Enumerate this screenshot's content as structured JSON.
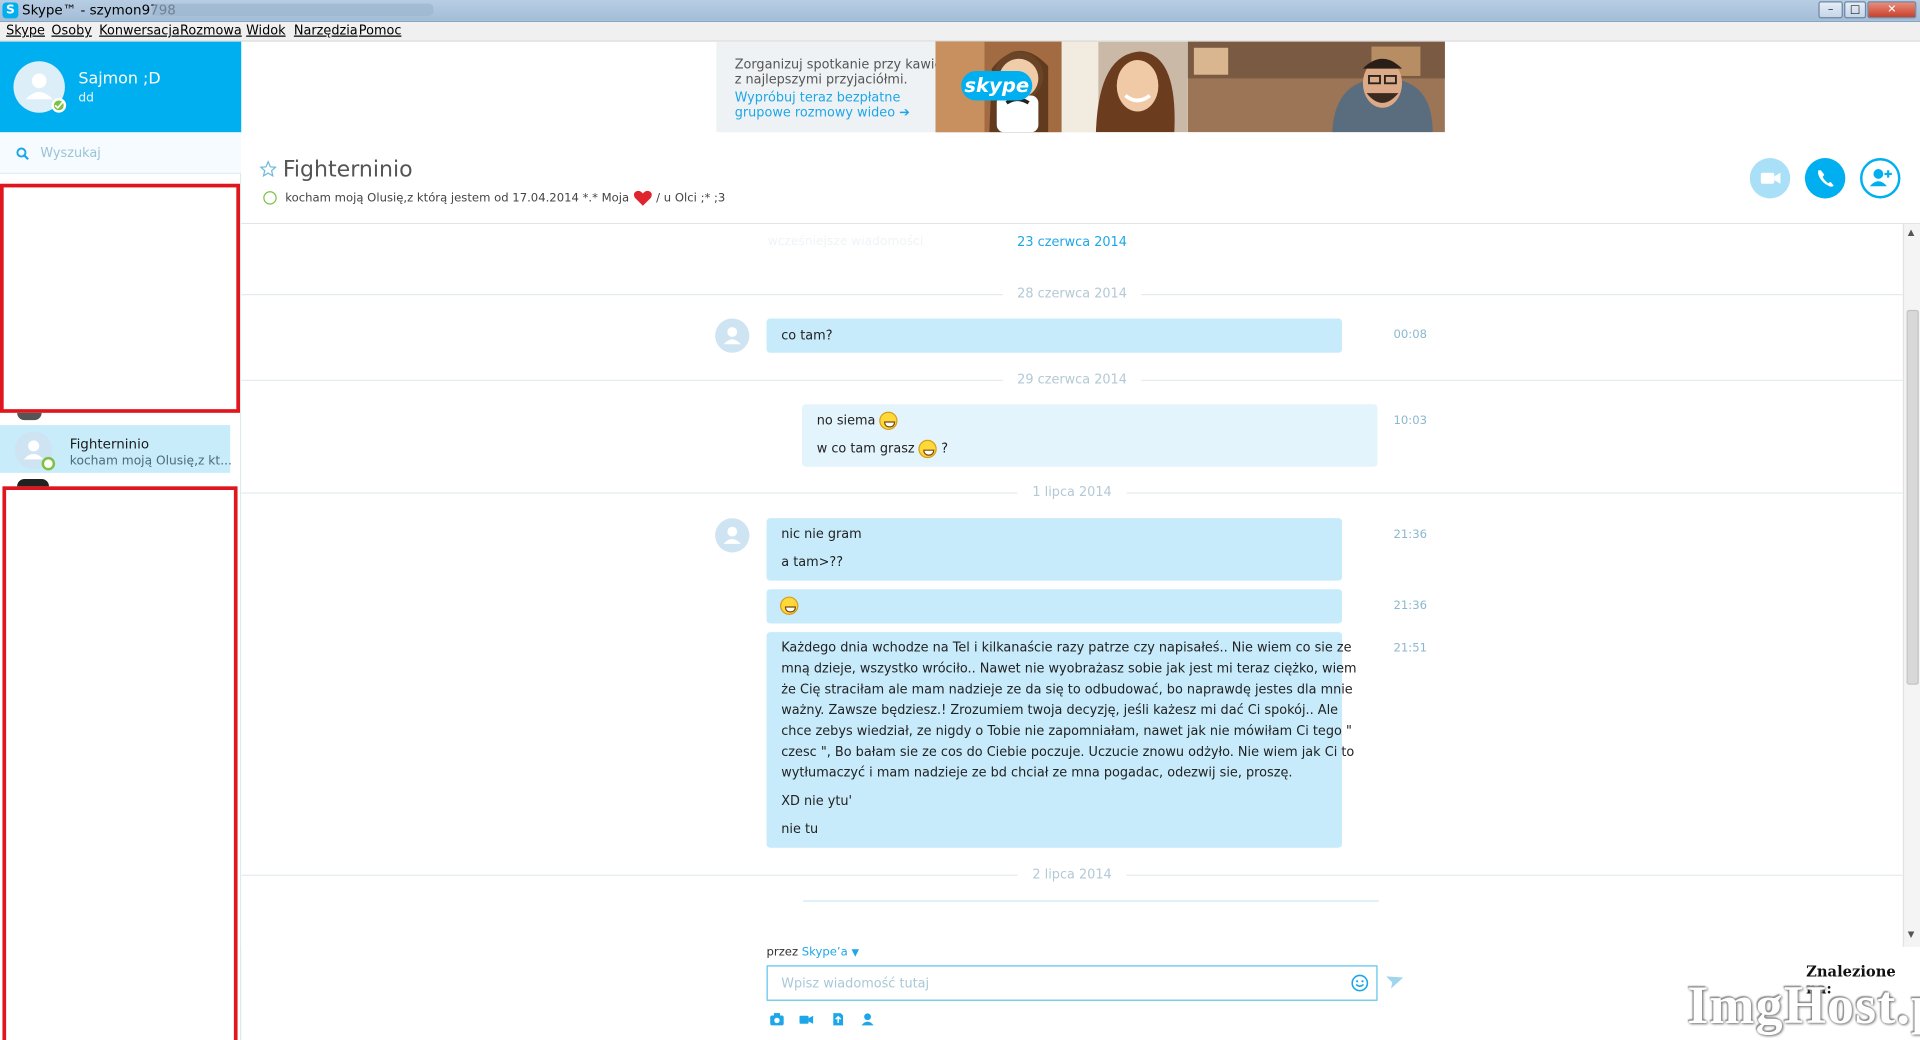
{
  "window": {
    "title": "Skype™ - szymon9798",
    "btn_min": "–",
    "btn_max": "□",
    "btn_close": "✕"
  },
  "menu": [
    "Skype",
    "Osoby",
    "Konwersacja",
    "Rozmowa",
    "Widok",
    "Narzędzia",
    "Pomoc"
  ],
  "profile": {
    "name": "Sajmon ;D",
    "mood": "dd"
  },
  "search": {
    "placeholder": "Wyszukaj"
  },
  "contact": {
    "name": "Fighterninio",
    "mood": "kocham moją Olusię,z kt..."
  },
  "banner": {
    "line1": "Zorganizuj spotkanie przy kawie z najlepszymi przyjaciółmi.",
    "line2": "Wypróbuj teraz bezpłatne grupowe rozmowy wideo ➔",
    "logo": "skype"
  },
  "conversation": {
    "title": "Fighterninio",
    "mood_before": "kocham moją Olusię,z którą jestem od 17.04.2014 *.* Moja",
    "mood_after": "/ u Olci ;* ;3"
  },
  "chat": {
    "top_link": "23 czerwca 2014",
    "groups": [
      {
        "date": "28 czerwca 2014",
        "messages": [
          {
            "side": "in",
            "lines": [
              "co tam?"
            ],
            "time": "00:08"
          }
        ]
      },
      {
        "date": "29 czerwca 2014",
        "messages": [
          {
            "side": "out",
            "lines": [
              "no siema",
              "w co tam grasz",
              "?"
            ],
            "time": "10:03"
          }
        ]
      },
      {
        "date": "1 lipca 2014",
        "messages": [
          {
            "side": "in",
            "lines": [
              "nic nie gram",
              "a tam>??"
            ],
            "time": "21:36"
          },
          {
            "side": "in",
            "lines": [],
            "time": "21:36"
          },
          {
            "side": "in",
            "lines": [
              "Każdego dnia wchodze na Tel i kilkanaście razy patrze czy napisałeś.. Nie wiem co sie ze",
              "mną dzieje, wszystko wróciło.. Nawet nie wyobrażasz sobie jak jest mi teraz ciężko, wiem",
              "że Cię straciłam ale mam nadzieje ze da się to odbudować, bo naprawdę jestes dla mnie",
              "ważny. Zawsze będziesz.! Zrozumiem twoja decyzję, jeśli każesz mi dać Ci spokój.. Ale",
              "chce zebys wiedział, ze nigdy o Tobie nie zapomniałam, nawet jak nie mówiłam Ci tego \"",
              "czesc \", Bo bałam sie ze cos do Ciebie poczuje. Uczucie znowu odżyło. Nie wiem jak Ci to",
              "wytłumaczyć i mam nadzieje ze bd chciał ze mna pogadac, odezwij sie, proszę.",
              "XD nie ytu'",
              "nie tu"
            ],
            "time": "21:51"
          }
        ]
      },
      {
        "date": "2 lipca 2014",
        "messages": []
      }
    ]
  },
  "composer": {
    "via_prefix": "przez",
    "via_link": "Skype’a",
    "placeholder": "Wpisz wiadomość tutaj"
  },
  "watermark": {
    "label": "Znalezione na:",
    "brand": "ImgHost.pl"
  },
  "colors": {
    "accent": "#00aff0",
    "bubble": "#c7ebfb",
    "redbox": "#e0151d"
  },
  "icons": [
    "search-icon",
    "star-icon",
    "video-call-icon",
    "call-icon",
    "add-contact-icon",
    "emoticon-icon",
    "send-icon",
    "camera-icon",
    "video-message-icon",
    "send-file-icon",
    "send-contact-icon"
  ]
}
